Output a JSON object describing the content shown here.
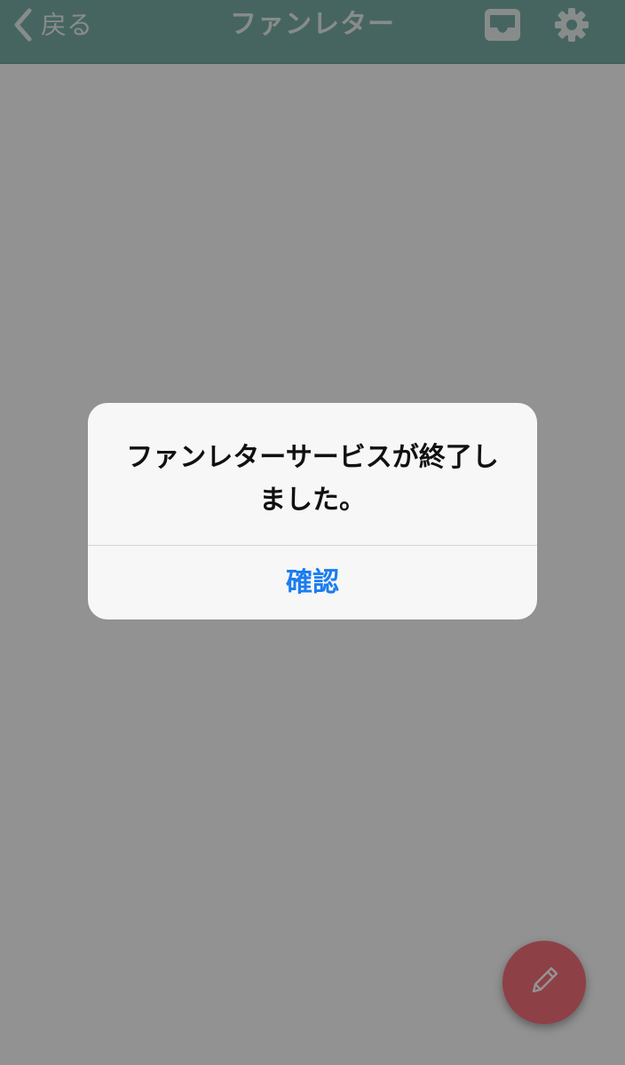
{
  "navbar": {
    "back_label": "戻る",
    "title": "ファンレター",
    "icons": {
      "back": "chevron-left-icon",
      "inbox": "inbox-tray-icon",
      "settings": "gear-icon"
    }
  },
  "fab": {
    "icon": "pencil-icon"
  },
  "alert": {
    "message": "ファンレターサービスが終了しました。",
    "confirm_label": "確認"
  },
  "colors": {
    "navbar": "#7aaea5",
    "fab": "#f46f7b",
    "action": "#1a7df0"
  }
}
